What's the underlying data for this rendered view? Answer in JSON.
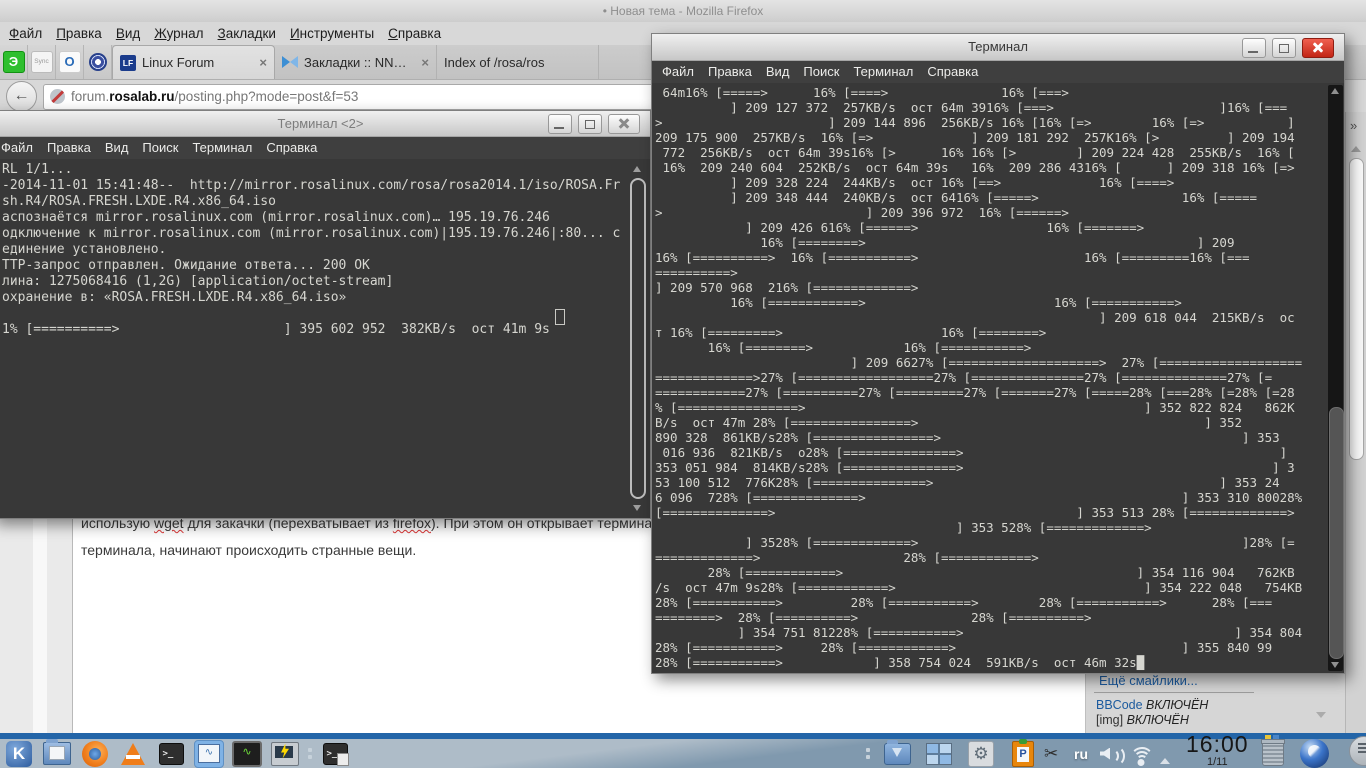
{
  "firefox": {
    "window_title": "• Новая тема - Mozilla Firefox",
    "menu": [
      "Файл",
      "Правка",
      "Вид",
      "Журнал",
      "Закладки",
      "Инструменты",
      "Справка"
    ],
    "pinned": {
      "elements_glyph": "Э",
      "sync_glyph": "Sync",
      "o_glyph": "O"
    },
    "tabs": {
      "tab1_label": "Linux Forum",
      "tab1_icon": "LF",
      "tab2_label": "Закладки :: NNM-Club",
      "tab3_label": "Index of /rosa/ros",
      "close_glyph": "×"
    },
    "nav": {
      "back_glyph": "←",
      "url_prefix": "forum.",
      "url_domain": "rosalab.ru",
      "url_path": "/posting.php?mode=post&f=53"
    },
    "overflow_chevron": "»",
    "page": {
      "post_l1a": "использую ",
      "post_l1_w1": "wget",
      "post_l1b": " для закачки (перехватывает из ",
      "post_l1_w2": "firefox",
      "post_l1c": "). При этом он открывает терминал для",
      "post_l2": "терминала, начинают происходить странные вещи.",
      "smilies_link": "Ещё смайлики...",
      "bbcode_name": "BBCode",
      "bbcode_state": "ВКЛЮЧЁН",
      "img_name": "[img]",
      "img_state": "ВКЛЮЧЁН"
    }
  },
  "terminal1": {
    "title": "Терминал <2>",
    "menu": [
      "Файл",
      "Правка",
      "Вид",
      "Поиск",
      "Терминал",
      "Справка"
    ],
    "lines": [
      "RL 1/1...",
      "-2014-11-01 15:41:48--  http://mirror.rosalinux.com/rosa/rosa2014.1/iso/ROSA.Fr",
      "sh.R4/ROSA.FRESH.LXDE.R4.x86_64.iso",
      "аспознаётся mirror.rosalinux.com (mirror.rosalinux.com)… 195.19.76.246",
      "одключение к mirror.rosalinux.com (mirror.rosalinux.com)|195.19.76.246|:80... с",
      "единение установлено.",
      "ТТР-запрос отправлен. Ожидание ответа... 200 OK",
      "лина: 1275068416 (1,2G) [application/octet-stream]",
      "охранение в: «ROSA.FRESH.LXDE.R4.x86_64.iso»",
      "",
      "1% [==========>                     ] 395 602 952  382KB/s  ост 41m 9s "
    ]
  },
  "terminal2": {
    "title": "Терминал",
    "menu": [
      "Файл",
      "Правка",
      "Вид",
      "Поиск",
      "Терминал",
      "Справка"
    ],
    "lines": [
      " 64m16% [=====>      16% [====>               16% [===>",
      "          ] 209 127 372  257KB/s  ост 64m 3916% [===>                      ]16% [===",
      ">                      ] 209 144 896  256KB/s 16% [16% [=>        16% [=>           ]",
      "209 175 900  257KB/s  16% [=>             ] 209 181 292  257K16% [>         ] 209 194",
      " 772  256KB/s  ост 64m 39s16% [>      16% 16% [>        ] 209 224 428  255KB/s  16% [",
      " 16%  209 240 604  252KB/s  ост 64m 39s   16%  209 286 4316% [      ] 209 318 16% [=>",
      "          ] 209 328 224  244KB/s  ост 16% [==>             16% [====>",
      "          ] 209 348 444  240KB/s  ост 6416% [=====>                   16% [=====",
      ">                           ] 209 396 972  16% [======>",
      "            ] 209 426 616% [======>                 16% [=======>",
      "              16% [========>                                            ] 209",
      "16% [==========>  16% [===========>                      16% [=========16% [===",
      "==========>",
      "] 209 570 968  216% [=============>",
      "          16% [============>                         16% [===========>",
      "                                                           ] 209 618 044  215KB/s  ос",
      "т 16% [=========>                     16% [========>",
      "       16% [========>            16% [===========>",
      "                          ] 209 6627% [====================>  27% [===================",
      "=============>27% [==================27% [===============27% [==============27% [=",
      "============27% [==========27% [=========27% [=======27% [=====28% [===28% [=28% [=28",
      "% [================>                                             ] 352 822 824   862K",
      "B/s  ост 47m 28% [================>                                      ] 352",
      "890 328  861KB/s28% [================>                                        ] 353",
      " 016 936  821KB/s  o28% [===============>                                          ]",
      "353 051 984  814KB/s28% [===============>                                         ] 3",
      "53 100 512  776K28% [===============>                                      ] 353 24",
      "6 096  728% [==============>                                          ] 353 310 80028%",
      "[==============>                                        ] 353 513 28% [=============>",
      "                                        ] 353 528% [=============>",
      "            ] 3528% [=============>                                           ]28% [=",
      "=============>                   28% [============>",
      "       28% [============>                                       ] 354 116 904   762KB",
      "/s  ост 47m 9s28% [============>                                 ] 354 222 048   754KB",
      "28% [===========>         28% [===========>        28% [===========>      28% [===",
      "========>  28% [==========>               28% [==========>",
      "           ] 354 751 81228% [===========>                                    ] 354 804",
      "28% [===========>     28% [============>                              ] 355 840 99",
      "28% [===========>            ] 358 754 024  591KB/s  ост 46m 32s█"
    ]
  },
  "taskbar": {
    "keyboard_layout": "ru",
    "clock_time": "16:00",
    "clock_date": "1/11"
  },
  "icons": {
    "k_logo": "K",
    "terminal_prompt": ">_",
    "waveform": "∿",
    "gear": "⚙",
    "scissors": "✂",
    "monitor_wave": "∿"
  }
}
